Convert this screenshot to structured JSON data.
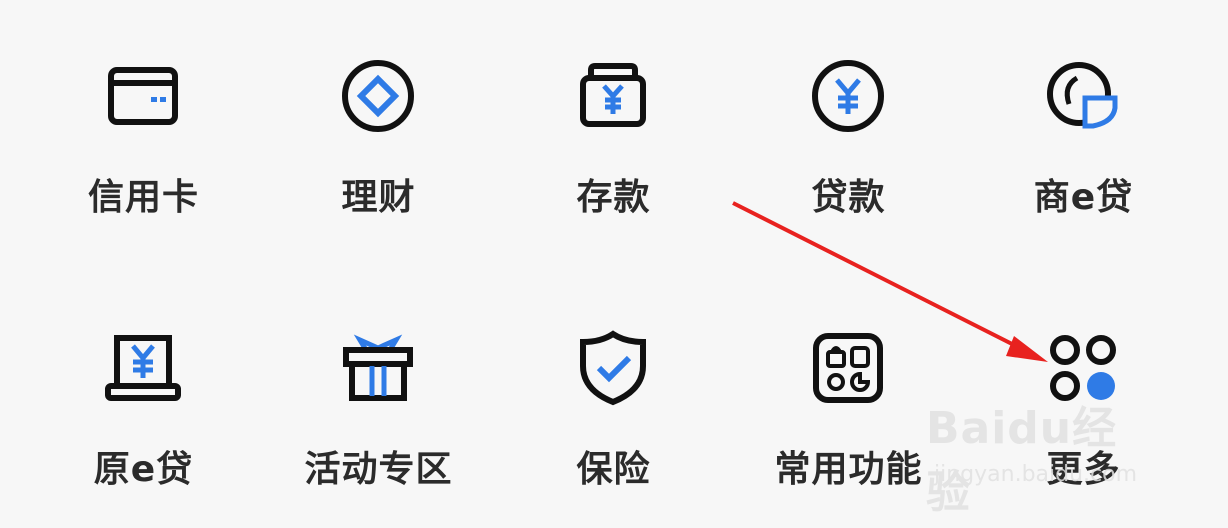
{
  "menu": {
    "items": [
      {
        "label": "信用卡",
        "icon": "credit-card-icon"
      },
      {
        "label": "理财",
        "icon": "wealth-management-icon"
      },
      {
        "label": "存款",
        "icon": "deposit-icon"
      },
      {
        "label": "贷款",
        "icon": "loan-icon"
      },
      {
        "label": "商e贷",
        "icon": "business-loan-icon"
      },
      {
        "label": "原e贷",
        "icon": "yuan-loan-icon"
      },
      {
        "label": "活动专区",
        "icon": "gift-icon"
      },
      {
        "label": "保险",
        "icon": "shield-icon"
      },
      {
        "label": "常用功能",
        "icon": "common-functions-icon"
      },
      {
        "label": "更多",
        "icon": "more-icon"
      }
    ]
  },
  "watermark": {
    "brand": "Baidu经验",
    "url": "jingyan.baidu.com"
  },
  "colors": {
    "accent": "#2f7be6",
    "icon_stroke": "#111111",
    "arrow": "#e8221f",
    "label": "#2b2b2b"
  }
}
